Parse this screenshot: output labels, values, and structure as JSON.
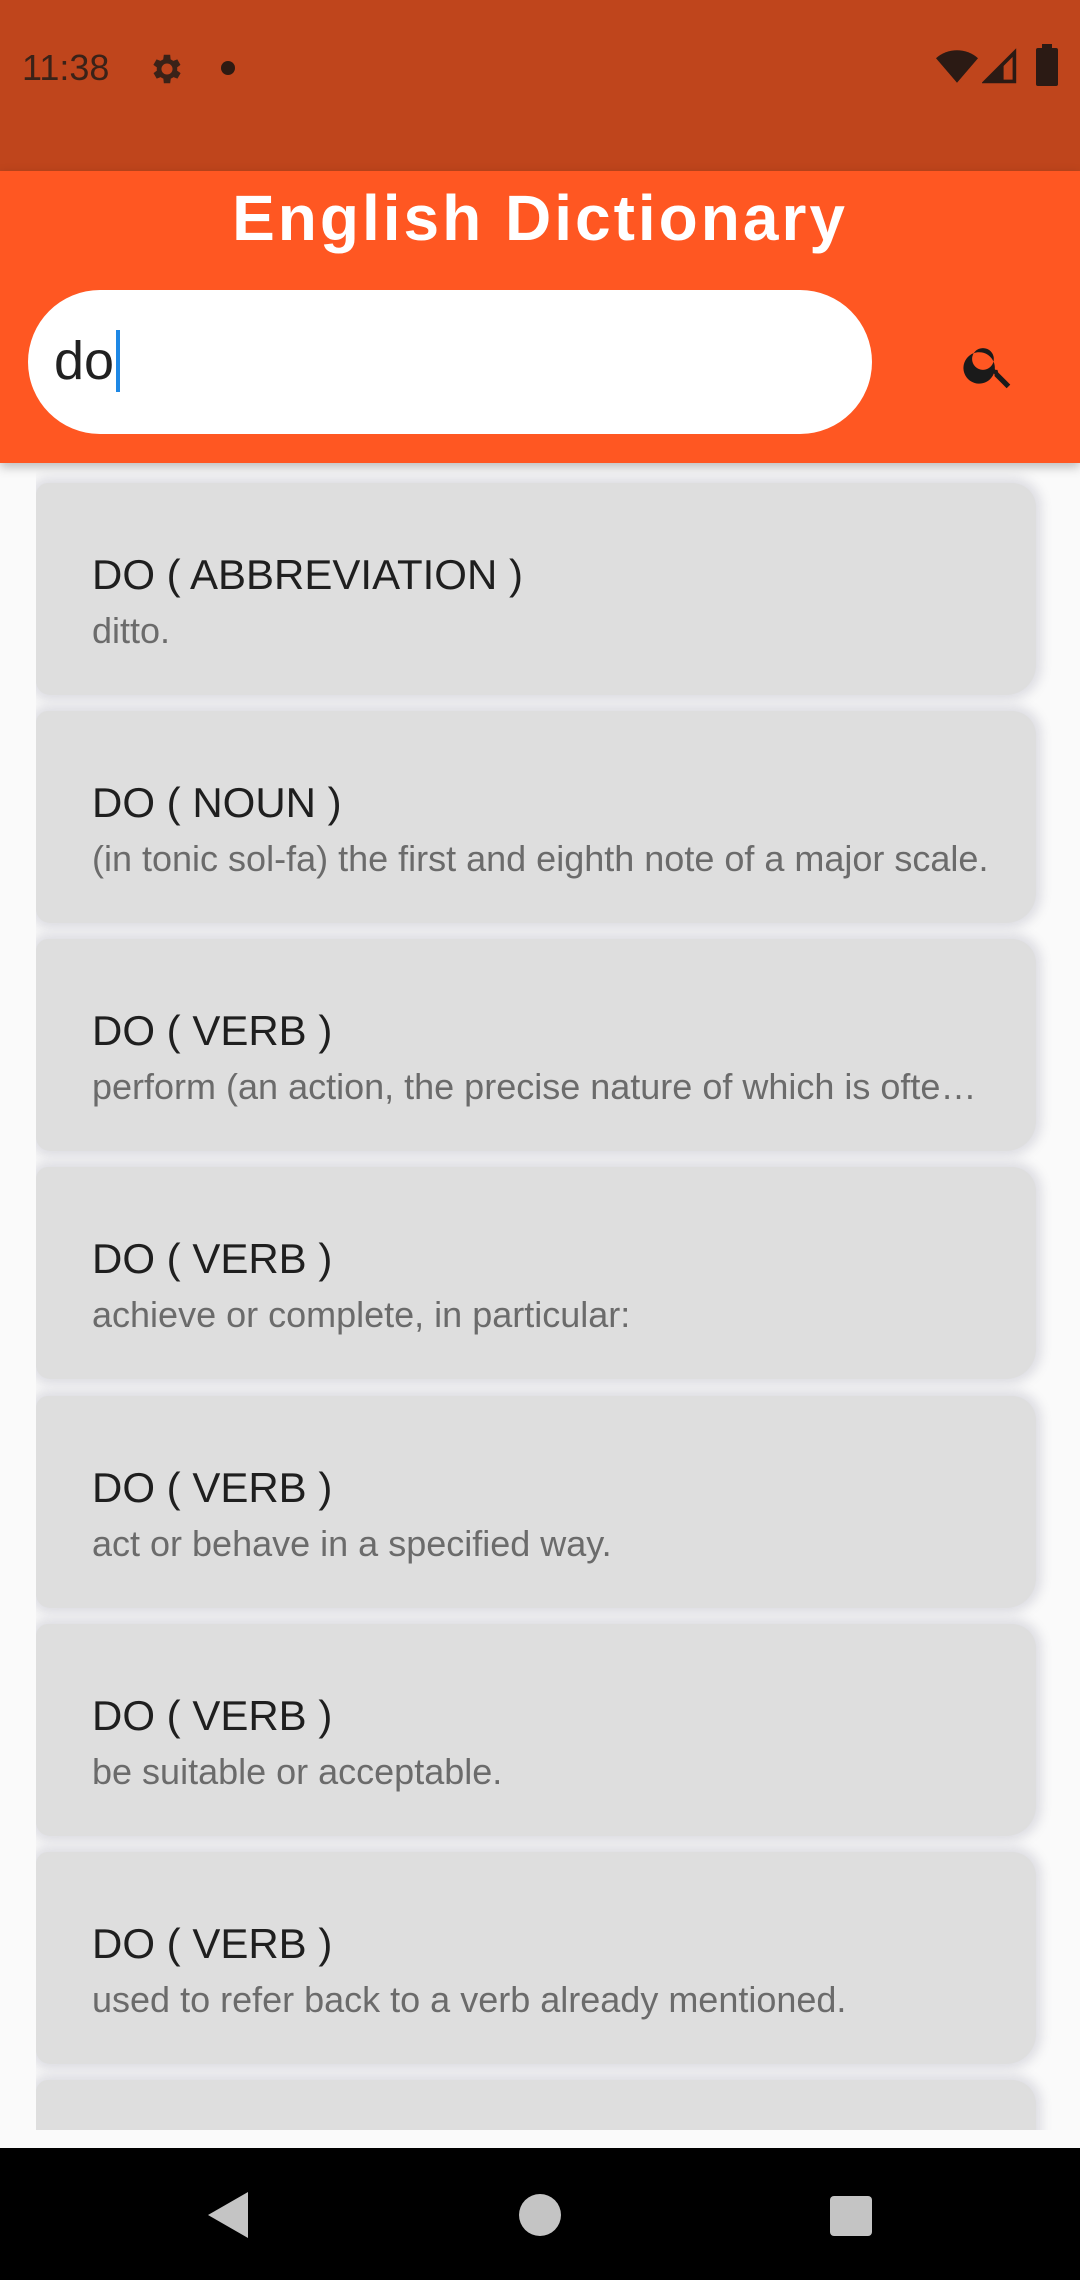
{
  "status_bar": {
    "time": "11:38",
    "icons": [
      "gear-icon",
      "notification-dot-icon",
      "wifi-icon",
      "cell-signal-icon",
      "battery-icon"
    ]
  },
  "header": {
    "title": "English Dictionary",
    "background_color": "#ff5722"
  },
  "search": {
    "value": "do",
    "button_icon": "search-icon"
  },
  "results": [
    {
      "title": "DO ( ABBREVIATION )",
      "definition": "ditto."
    },
    {
      "title": "DO ( NOUN )",
      "definition": "(in tonic sol-fa) the first and eighth note of a major scale."
    },
    {
      "title": "DO ( VERB )",
      "definition": "perform (an action, the precise nature of which is often unspecified)."
    },
    {
      "title": "DO ( VERB )",
      "definition": "achieve or complete, in particular:"
    },
    {
      "title": "DO ( VERB )",
      "definition": "act or behave in a specified way."
    },
    {
      "title": "DO ( VERB )",
      "definition": "be suitable or acceptable."
    },
    {
      "title": "DO ( VERB )",
      "definition": "used to refer back to a verb already mentioned."
    },
    {
      "title": "",
      "definition": ""
    }
  ],
  "nav_bar": {
    "icons": [
      "back-icon",
      "home-icon",
      "recents-icon"
    ]
  }
}
